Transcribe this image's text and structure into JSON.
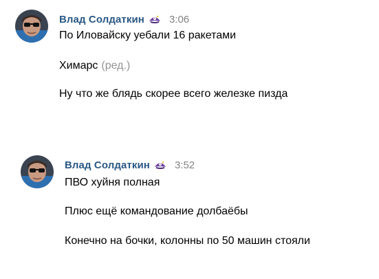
{
  "messages": [
    {
      "author": "Влад Солдаткин",
      "time": "3:06",
      "lines": [
        {
          "text": "По Иловайску уебали 16 ракетами"
        },
        {
          "text": "Химарс",
          "edited": "(ред.)"
        },
        {
          "text": "Ну что же блядь скорее всего железке пизда"
        }
      ]
    },
    {
      "author": "Влад Солдаткин",
      "time": "3:52",
      "lines": [
        {
          "text": "ПВО хуйня полная"
        },
        {
          "text": "Плюс ещё командование долбаёбы"
        },
        {
          "text": "Конечно на бочки, колонны по 50 машин стояли"
        }
      ]
    }
  ],
  "colors": {
    "author": "#2a5885",
    "time": "#828282",
    "edited": "#939393",
    "text": "#000000"
  },
  "icons": {
    "badge": "pirate-hat-badge-icon",
    "avatar": "user-avatar-sunglasses"
  }
}
